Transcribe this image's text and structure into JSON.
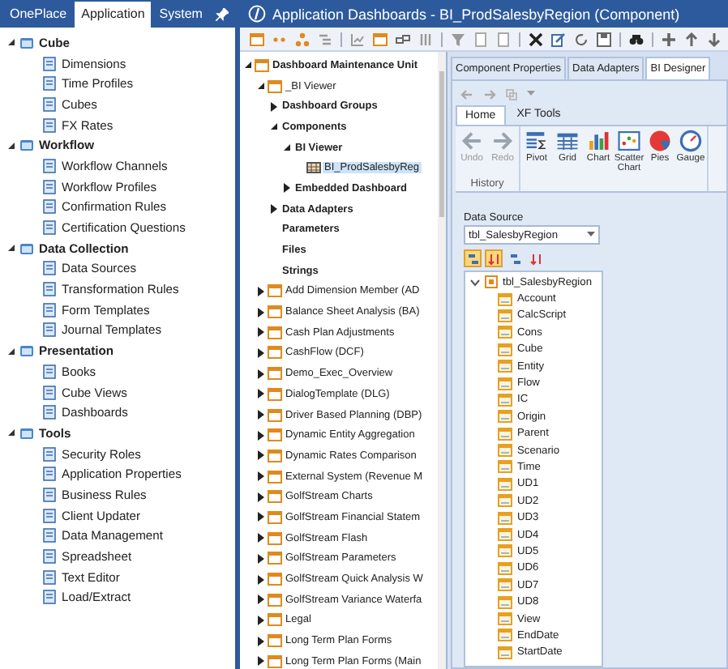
{
  "left_panel": {
    "tabs": [
      {
        "label": "OnePlace",
        "selected": false
      },
      {
        "label": "Application",
        "selected": true
      },
      {
        "label": "System",
        "selected": false
      }
    ],
    "tree": [
      {
        "label": "Cube",
        "expanded": true,
        "children": [
          {
            "label": "Dimensions"
          },
          {
            "label": "Time Profiles"
          },
          {
            "label": "Cubes"
          },
          {
            "label": "FX Rates"
          }
        ]
      },
      {
        "label": "Workflow",
        "expanded": true,
        "children": [
          {
            "label": "Workflow Channels"
          },
          {
            "label": "Workflow Profiles"
          },
          {
            "label": "Confirmation Rules"
          },
          {
            "label": "Certification Questions"
          }
        ]
      },
      {
        "label": "Data Collection",
        "expanded": true,
        "children": [
          {
            "label": "Data Sources"
          },
          {
            "label": "Transformation Rules"
          },
          {
            "label": "Form Templates"
          },
          {
            "label": "Journal Templates"
          }
        ]
      },
      {
        "label": "Presentation",
        "expanded": true,
        "children": [
          {
            "label": "Books"
          },
          {
            "label": "Cube Views"
          },
          {
            "label": "Dashboards"
          }
        ]
      },
      {
        "label": "Tools",
        "expanded": true,
        "children": [
          {
            "label": "Security Roles"
          },
          {
            "label": "Application Properties"
          },
          {
            "label": "Business Rules"
          },
          {
            "label": "Client Updater"
          },
          {
            "label": "Data Management"
          },
          {
            "label": "Spreadsheet"
          },
          {
            "label": "Text Editor"
          },
          {
            "label": "Load/Extract"
          }
        ]
      }
    ]
  },
  "window": {
    "title": "Application Dashboards - BI_ProdSalesbyRegion (Component)"
  },
  "dashboard_tree": [
    {
      "label": "Dashboard Maintenance Unit",
      "expanded": true,
      "children": [
        {
          "label": "_BI Viewer",
          "expanded": true,
          "children": [
            {
              "label": "Dashboard Groups",
              "expanded": false
            },
            {
              "label": "Components",
              "expanded": true,
              "children": [
                {
                  "label": "BI Viewer",
                  "expanded": true,
                  "children": [
                    {
                      "label": "BI_ProdSalesbyReg",
                      "selected": true
                    }
                  ]
                },
                {
                  "label": "Embedded Dashboard",
                  "expanded": false
                }
              ]
            },
            {
              "label": "Data Adapters",
              "expanded": false
            },
            {
              "label": "Parameters"
            },
            {
              "label": "Files"
            },
            {
              "label": "Strings"
            }
          ]
        },
        {
          "label": "Add Dimension Member (AD",
          "expanded": false
        },
        {
          "label": "Balance Sheet Analysis (BA)",
          "expanded": false
        },
        {
          "label": "Cash Plan Adjustments",
          "expanded": false
        },
        {
          "label": "CashFlow (DCF)",
          "expanded": false
        },
        {
          "label": "Demo_Exec_Overview",
          "expanded": false
        },
        {
          "label": "DialogTemplate (DLG)",
          "expanded": false
        },
        {
          "label": "Driver Based Planning (DBP)",
          "expanded": false
        },
        {
          "label": "Dynamic Entity Aggregation",
          "expanded": false
        },
        {
          "label": "Dynamic Rates Comparison",
          "expanded": false
        },
        {
          "label": "External System (Revenue M",
          "expanded": false
        },
        {
          "label": "GolfStream Charts",
          "expanded": false
        },
        {
          "label": "GolfStream Financial Statem",
          "expanded": false
        },
        {
          "label": "GolfStream Flash",
          "expanded": false
        },
        {
          "label": "GolfStream Parameters",
          "expanded": false
        },
        {
          "label": "GolfStream Quick Analysis W",
          "expanded": false
        },
        {
          "label": "GolfStream Variance Waterfa",
          "expanded": false
        },
        {
          "label": "Legal",
          "expanded": false
        },
        {
          "label": "Long Term Plan Forms",
          "expanded": false
        },
        {
          "label": "Long Term Plan Forms (Main",
          "expanded": false
        }
      ]
    }
  ],
  "editor_tabs": [
    {
      "label": "Component Properties",
      "selected": false
    },
    {
      "label": "Data Adapters",
      "selected": false
    },
    {
      "label": "BI Designer",
      "selected": true
    }
  ],
  "ribbon": {
    "tabs": [
      {
        "label": "Home",
        "selected": true
      },
      {
        "label": "XF Tools",
        "selected": false
      }
    ],
    "groups": [
      {
        "label": "History",
        "buttons": [
          {
            "kind": "undo",
            "label": "Undo",
            "disabled": true
          },
          {
            "kind": "redo",
            "label": "Redo",
            "disabled": true
          }
        ]
      },
      {
        "buttons": [
          {
            "kind": "pivot",
            "label": "Pivot",
            "disabled": false
          },
          {
            "kind": "grid",
            "label": "Grid",
            "disabled": false
          },
          {
            "kind": "chart",
            "label": "Chart",
            "disabled": false
          },
          {
            "kind": "scatter",
            "label": "Scatter Chart",
            "disabled": false
          },
          {
            "kind": "pie",
            "label": "Pies",
            "disabled": false
          },
          {
            "kind": "gauge",
            "label": "Gauge",
            "disabled": false
          }
        ]
      }
    ]
  },
  "data_source": {
    "label": "Data Source",
    "value": "tbl_SalesbyRegion"
  },
  "field_toolbar": [
    {
      "selected": true
    },
    {
      "selected": true
    },
    {
      "selected": false
    },
    {
      "selected": false
    }
  ],
  "field_list": {
    "label": "tbl_SalesbyRegion",
    "expanded": true,
    "fields": [
      "Account",
      "CalcScript",
      "Cons",
      "Cube",
      "Entity",
      "Flow",
      "IC",
      "Origin",
      "Parent",
      "Scenario",
      "Time",
      "UD1",
      "UD2",
      "UD3",
      "UD4",
      "UD5",
      "UD6",
      "UD7",
      "UD8",
      "View",
      "EndDate",
      "StartDate"
    ]
  }
}
